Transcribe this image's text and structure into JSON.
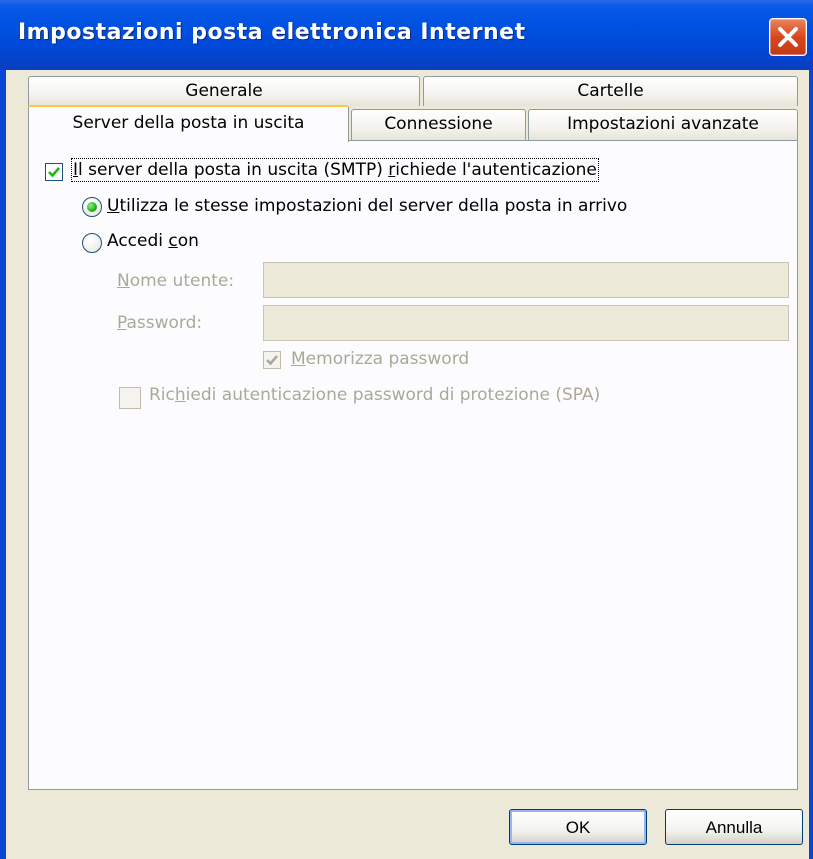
{
  "window": {
    "title": "Impostazioni posta elettronica Internet"
  },
  "tabs": {
    "generale": "Generale",
    "cartelle": "Cartelle",
    "server_uscita": "Server della posta in uscita",
    "connessione": "Connessione",
    "avanzate": "Impostazioni avanzate",
    "active": "Server della posta in uscita"
  },
  "smtp_auth": {
    "checked": true,
    "label_pre": "",
    "label_ul1": "I",
    "label_mid": "l server della posta in uscita (SMTP) ",
    "label_ul2": "r",
    "label_post": "ichiede l'autenticazione"
  },
  "radio_same": {
    "selected": true,
    "label_ul": "U",
    "label_rest": "tilizza le stesse impostazioni del server della posta in arrivo"
  },
  "radio_login": {
    "selected": false,
    "label_pre": "Accedi ",
    "label_ul": "c",
    "label_post": "on"
  },
  "username": {
    "label_ul": "N",
    "label_rest": "ome utente:",
    "value": ""
  },
  "password": {
    "label_ul": "P",
    "label_rest": "assword:",
    "value": ""
  },
  "remember_password": {
    "checked": true,
    "label_ul": "M",
    "label_rest": "emorizza password"
  },
  "spa": {
    "checked": false,
    "label_pre": "Ric",
    "label_ul": "h",
    "label_post": "iedi autenticazione password di protezione (SPA)"
  },
  "buttons": {
    "ok": "OK",
    "cancel": "Annulla"
  },
  "colors": {
    "titlebar": "#0050e0",
    "close_button": "#d9461e",
    "active_tab_accent": "#ffc83c",
    "check_green": "#22b21a"
  }
}
